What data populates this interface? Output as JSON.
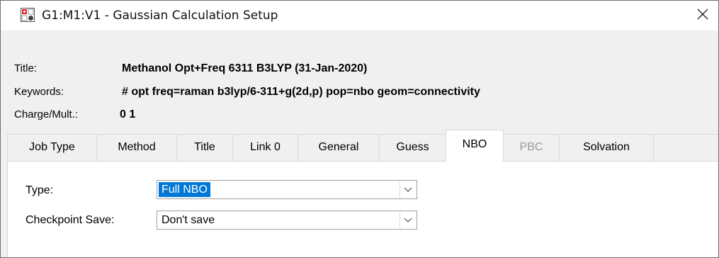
{
  "window": {
    "title": "G1:M1:V1 - Gaussian Calculation Setup",
    "close_glyph": "✕"
  },
  "info": {
    "title_label": "Title:",
    "title_value": "Methanol Opt+Freq 6311 B3LYP (31-Jan-2020)",
    "keywords_label": "Keywords:",
    "keywords_value": "# opt freq=raman b3lyp/6-311+g(2d,p) pop=nbo geom=connectivity",
    "charge_label": "Charge/Mult.:",
    "charge_value": "0 1"
  },
  "tabs": [
    {
      "label": "Job Type",
      "state": "normal"
    },
    {
      "label": "Method",
      "state": "normal"
    },
    {
      "label": "Title",
      "state": "normal"
    },
    {
      "label": "Link 0",
      "state": "normal"
    },
    {
      "label": "General",
      "state": "normal"
    },
    {
      "label": "Guess",
      "state": "normal"
    },
    {
      "label": "NBO",
      "state": "active"
    },
    {
      "label": "PBC",
      "state": "disabled"
    },
    {
      "label": "Solvation",
      "state": "normal"
    }
  ],
  "nbo": {
    "type_label": "Type:",
    "type_value": "Full NBO",
    "checkpoint_label": "Checkpoint Save:",
    "checkpoint_value": "Don't save"
  },
  "colors": {
    "selection": "#0078d7",
    "disabled_text": "#9a9a9a"
  },
  "icons": [
    "gaussview-app-icon",
    "close-icon",
    "dropdown-arrow-icon"
  ]
}
